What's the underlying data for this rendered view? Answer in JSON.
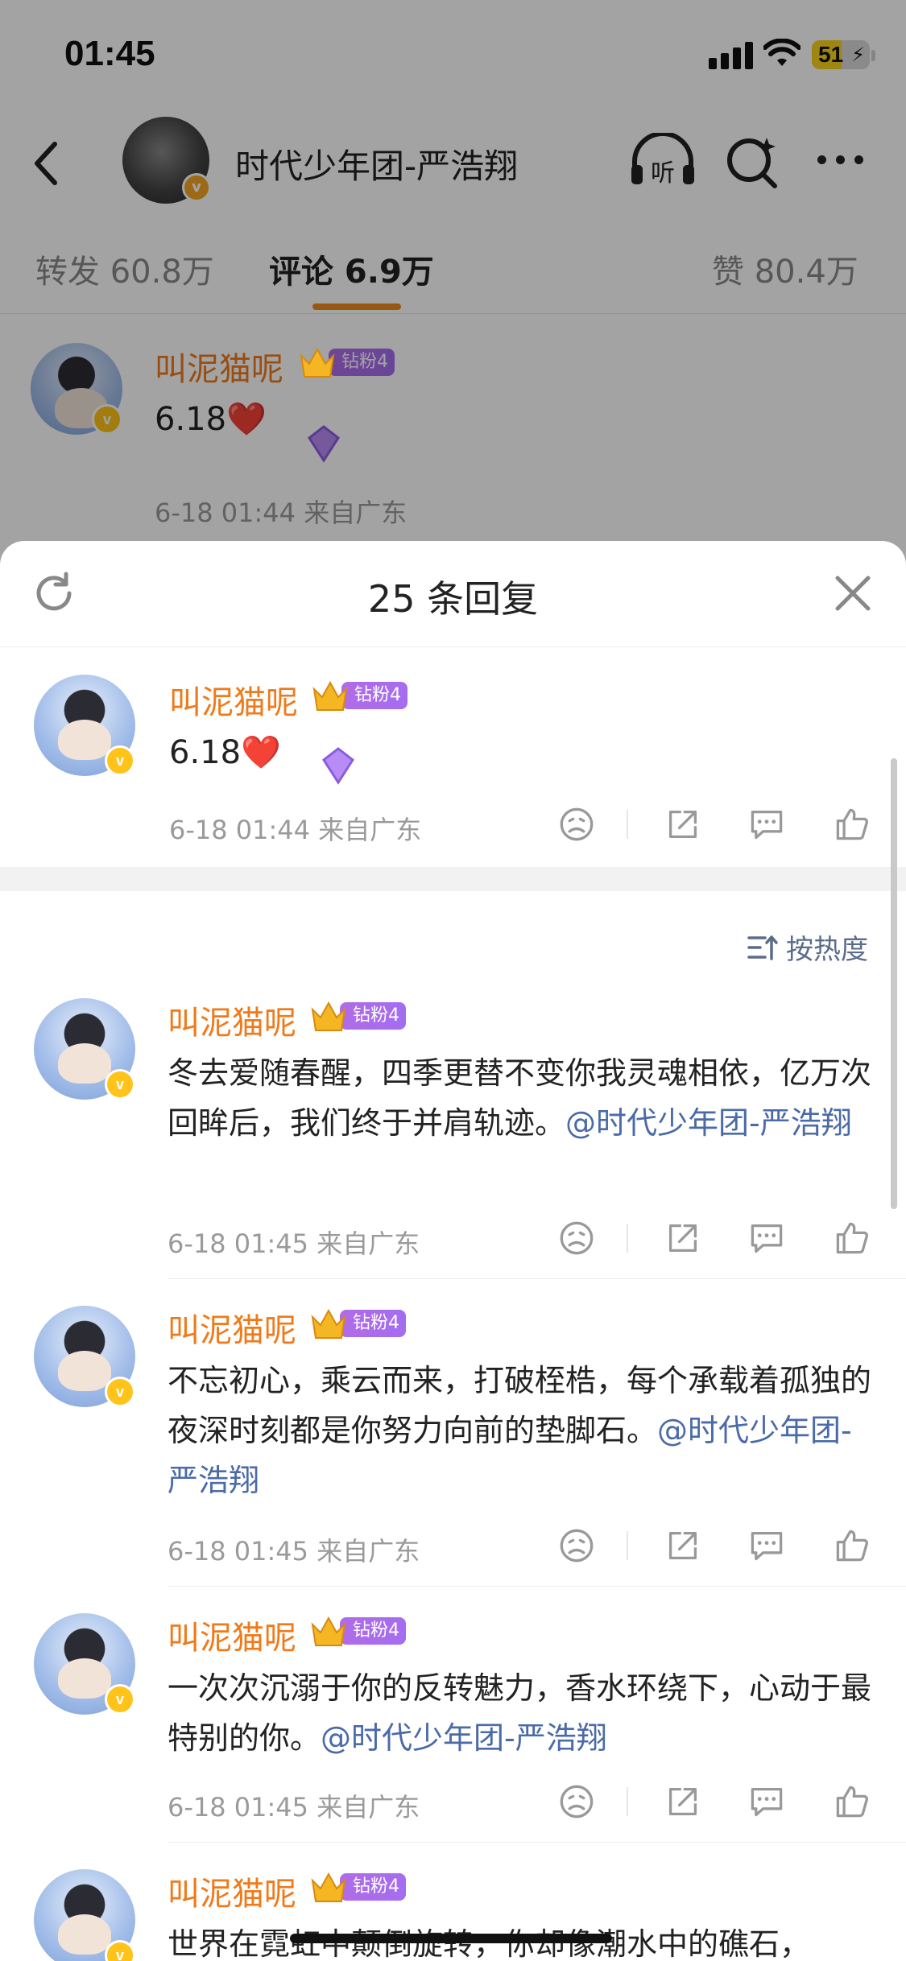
{
  "status_bar": {
    "time": "01:45",
    "battery": "51",
    "battery_level": 0.51
  },
  "nav": {
    "title": "时代少年团-严浩翔"
  },
  "tabs": {
    "repost": "转发 60.8万",
    "comments": "评论 6.9万",
    "likes": "赞 80.4万"
  },
  "background_comment": {
    "username": "叫泥猫呢",
    "badge": "钻粉4",
    "text": "6.18❤️",
    "meta": "6-18 01:44  来自广东"
  },
  "sheet": {
    "title": "25 条回复",
    "sort_label": "按热度",
    "original": {
      "username": "叫泥猫呢",
      "badge": "钻粉4",
      "text": "6.18❤️",
      "meta": "6-18 01:44  来自广东"
    },
    "replies": [
      {
        "username": "叫泥猫呢",
        "badge": "钻粉4",
        "text": "冬去爱随春醒，四季更替不变你我灵魂相依，亿万次回眸后，我们终于并肩轨迹。",
        "mention": "@时代少年团-严浩翔",
        "meta": "6-18 01:45  来自广东"
      },
      {
        "username": "叫泥猫呢",
        "badge": "钻粉4",
        "text": "不忘初心，乘云而来，打破桎梏，每个承载着孤独的夜深时刻都是你努力向前的垫脚石。",
        "mention": "@时代少年团-严浩翔",
        "meta": "6-18 01:45  来自广东"
      },
      {
        "username": "叫泥猫呢",
        "badge": "钻粉4",
        "text": "一次次沉溺于你的反转魅力，香水环绕下，心动于最特别的你。",
        "mention": "@时代少年团-严浩翔",
        "meta": "6-18 01:45  来自广东"
      },
      {
        "username": "叫泥猫呢",
        "badge": "钻粉4",
        "text": "世界在霓虹中颠倒旋转，你却像潮水中的礁石，",
        "mention": "",
        "meta": ""
      }
    ]
  },
  "icons": [
    "back-icon",
    "headphone-icon",
    "search-spark-icon",
    "more-icon",
    "refresh-icon",
    "close-icon",
    "sort-icon",
    "dislike-icon",
    "share-icon",
    "comment-icon",
    "like-icon"
  ],
  "colors": {
    "username": "#f07a1a",
    "mention": "#4a6aa8",
    "fan_badge": "#a46df0",
    "tab_underline": "#f08a1c",
    "verified": "#ffc31a"
  }
}
